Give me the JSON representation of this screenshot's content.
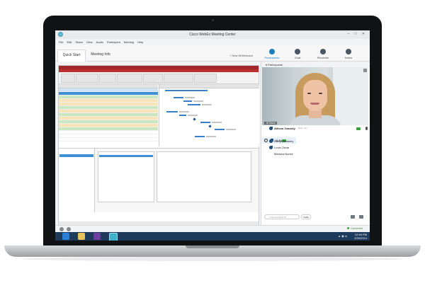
{
  "window": {
    "title": "Cisco WebEx Meeting Center",
    "controls": "–  □  ✕"
  },
  "menu": [
    "File",
    "Edit",
    "Share",
    "View",
    "Audio",
    "Participant",
    "Meeting",
    "Help"
  ],
  "tabs": [
    {
      "label": "Quick Start",
      "active": true
    },
    {
      "label": "Meeting Info",
      "active": false
    }
  ],
  "new_whiteboard": "+ New Whiteboard",
  "panel_buttons": [
    {
      "label": "Participants",
      "icon": "participants-icon",
      "active": true
    },
    {
      "label": "Chat",
      "icon": "chat-icon",
      "active": false
    },
    {
      "label": "Recorder",
      "icon": "recorder-icon",
      "active": false
    },
    {
      "label": "Notes",
      "icon": "notes-icon",
      "active": false
    }
  ],
  "participants": {
    "header": "▾ Participants",
    "video_label": "Jill Baker",
    "list": [
      {
        "name": "Allison Cassidy",
        "role": "Host, me",
        "bold": true,
        "camera": true,
        "selected": false
      },
      {
        "name": "Jill Baker",
        "role": "",
        "bold": false,
        "camera": true,
        "selected": true
      },
      {
        "name": "Donya Delaney",
        "role": "",
        "bold": false,
        "camera": false,
        "selected": false
      },
      {
        "name": "Louis Oscar",
        "role": "",
        "bold": false,
        "camera": false,
        "selected": false
      },
      {
        "name": "Marissa Nunez",
        "role": "",
        "bold": false,
        "camera": false,
        "selected": false
      }
    ],
    "invite_placeholder": "Invite and Remind",
    "invite_button": "Invite"
  },
  "status": {
    "connected": "Connected"
  },
  "taskbar": {
    "time": "12:46 PM",
    "date": "2/20/2014"
  },
  "colors": {
    "accent": "#1c7fc0",
    "project_red": "#a3262a",
    "taskbar": "#1f3b5c",
    "connected_green": "#3aa23a"
  }
}
